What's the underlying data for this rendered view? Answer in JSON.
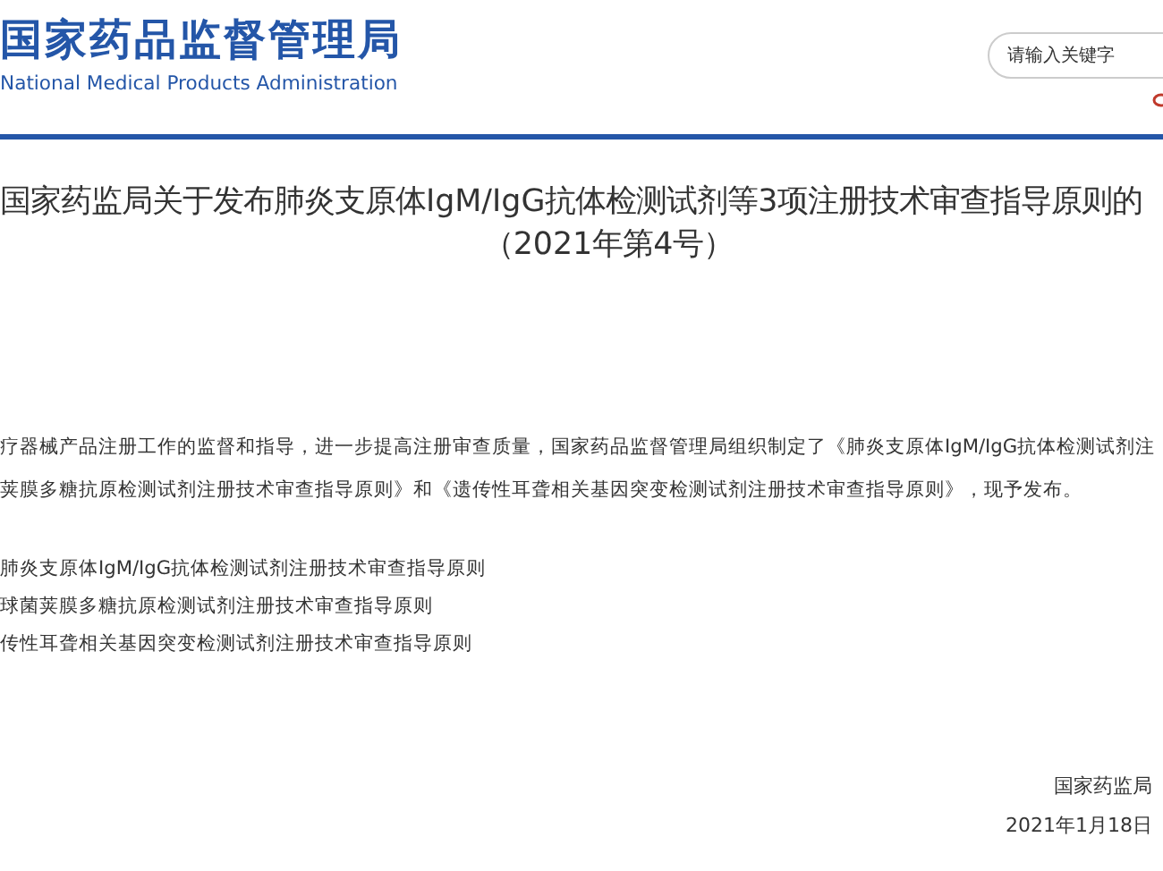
{
  "header": {
    "logo_title": "国家药品监督管理局",
    "logo_subtitle": "National Medical Products Administration",
    "search": {
      "placeholder": "请输入关键字"
    }
  },
  "article": {
    "title": "国家药监局关于发布肺炎支原体IgM/IgG抗体检测试剂等3项注册技术审查指导原则的",
    "number": "（2021年第4号）",
    "paragraph_lines": [
      "疗器械产品注册工作的监督和指导，进一步提高注册审查质量，国家药品监督管理局组织制定了《肺炎支原体IgM/IgG抗体检测试剂注",
      "荚膜多糖抗原检测试剂注册技术审查指导原则》和《遗传性耳聋相关基因突变检测试剂注册技术审查指导原则》，现予发布。"
    ],
    "attachments": [
      "肺炎支原体IgM/IgG抗体检测试剂注册技术审查指导原则",
      "球菌荚膜多糖抗原检测试剂注册技术审查指导原则",
      "传性耳聋相关基因突变检测试剂注册技术审查指导原则"
    ],
    "signature": "国家药监局",
    "date": "2021年1月18日"
  }
}
